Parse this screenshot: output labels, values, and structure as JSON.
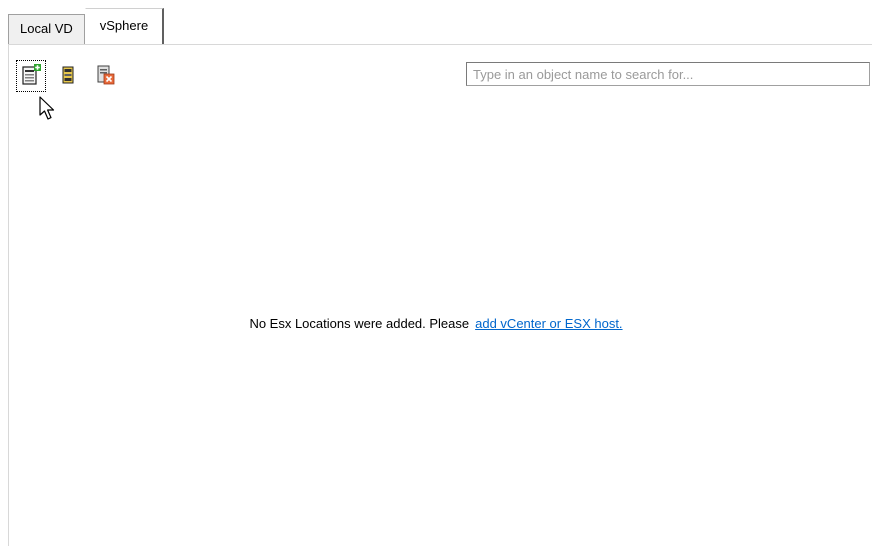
{
  "tabs": [
    {
      "label": "Local VD",
      "active": false
    },
    {
      "label": "vSphere",
      "active": true
    }
  ],
  "toolbar": {
    "buttons": [
      {
        "icon": "add-host-icon",
        "focused": true
      },
      {
        "icon": "server-icon",
        "focused": false
      },
      {
        "icon": "remove-host-icon",
        "focused": false
      }
    ]
  },
  "search": {
    "placeholder": "Type in an object name to search for...",
    "value": ""
  },
  "empty_state": {
    "message": "No Esx Locations were added. Please",
    "link_text": "add vCenter or ESX host."
  },
  "colors": {
    "link": "#0066cc",
    "border": "#a0a0a0"
  }
}
